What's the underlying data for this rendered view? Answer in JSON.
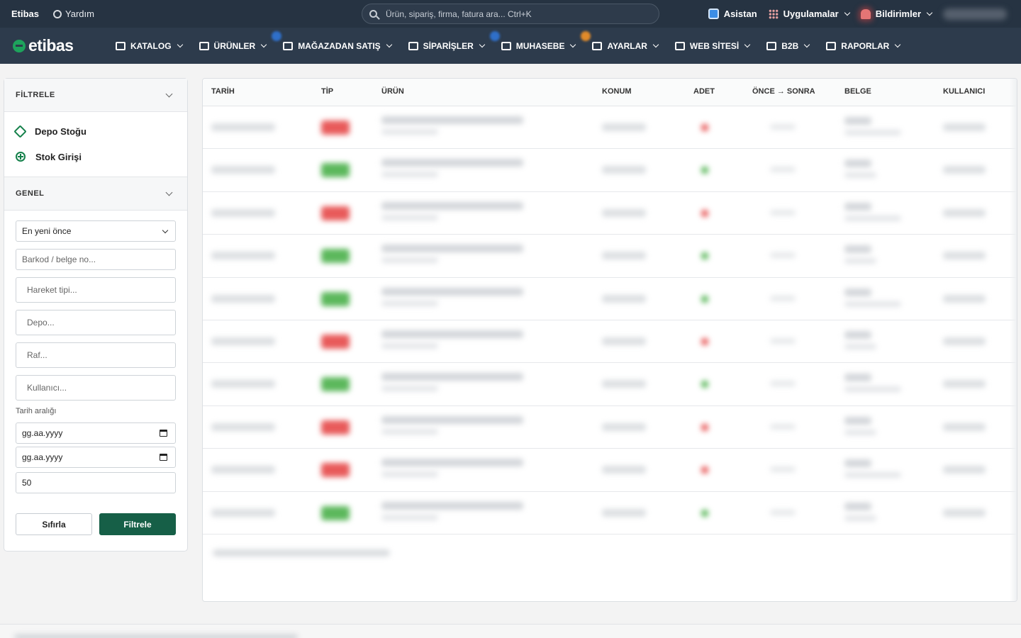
{
  "topbar": {
    "brand": "Etibas",
    "help_label": "Yardım",
    "search_placeholder": "Ürün, sipariş, firma, fatura ara...",
    "search_shortcut": "Ctrl+K",
    "assistant_label": "Asistan",
    "apps_label": "Uygulamalar",
    "notifications_label": "Bildirimler"
  },
  "navbar": {
    "logo_text": "etibas",
    "items": [
      {
        "label": "KATALOG",
        "icon": "books-icon"
      },
      {
        "label": "ÜRÜNLER",
        "icon": "tag-icon"
      },
      {
        "label": "MAĞAZADAN SATIŞ",
        "icon": "cash-register-icon"
      },
      {
        "label": "SİPARİŞLER",
        "icon": "cart-icon"
      },
      {
        "label": "MUHASEBE",
        "icon": "calculator-icon"
      },
      {
        "label": "AYARLAR",
        "icon": "gear-icon"
      },
      {
        "label": "WEB SİTESİ",
        "icon": "globe-icon"
      },
      {
        "label": "B2B",
        "icon": "store-icon"
      },
      {
        "label": "RAPORLAR",
        "icon": "chart-icon"
      }
    ],
    "badge_colors": {
      "urunler": "#2f6fc9",
      "siparisler": "#2f6fc9",
      "muhasebe": "#e08a2a"
    }
  },
  "sidebar": {
    "filter_title": "FİLTRELE",
    "links": [
      {
        "label": "Depo Stoğu",
        "icon": "cube-icon"
      },
      {
        "label": "Stok Girişi",
        "icon": "plus-circle-icon"
      }
    ],
    "general_title": "GENEL",
    "sort_value": "En yeni önce",
    "barcode_placeholder": "Barkod / belge no...",
    "movement_type_placeholder": "Hareket tipi...",
    "warehouse_placeholder": "Depo...",
    "shelf_placeholder": "Raf...",
    "user_placeholder": "Kullanıcı...",
    "date_range_label": "Tarih aralığı",
    "date_from": "gg.aa.yyyy",
    "date_to": "gg.aa.yyyy",
    "limit_value": "50",
    "reset_label": "Sıfırla",
    "filter_label": "Filtrele",
    "accent_color": "#165f47"
  },
  "table": {
    "columns": [
      "TARİH",
      "TİP",
      "ÜRÜN",
      "KONUM",
      "ADET",
      "ÖNCE → SONRA",
      "BELGE",
      "KULLANICI"
    ],
    "row_types": [
      "out",
      "in",
      "out",
      "in",
      "in",
      "out",
      "in",
      "out",
      "out",
      "in"
    ],
    "type_colors": {
      "out": "#e85a5a",
      "in": "#5cb85c"
    }
  }
}
